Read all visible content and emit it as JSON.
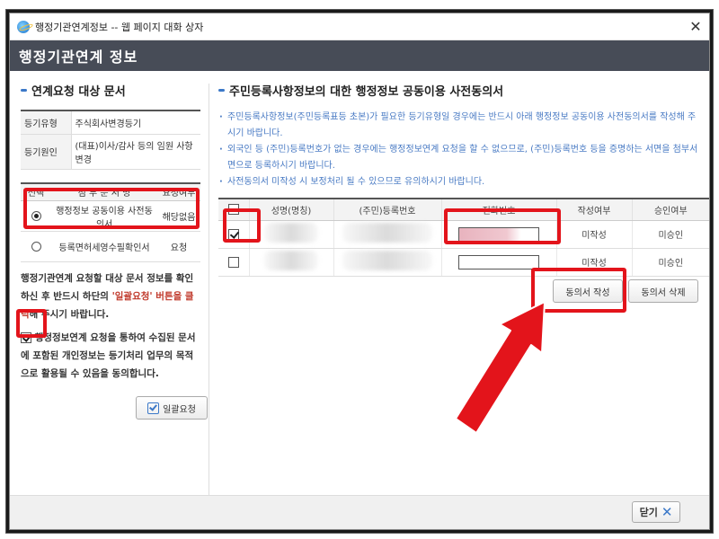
{
  "window": {
    "title": "행정기관연계정보 -- 웹 페이지 대화 상자",
    "close_glyph": "✕"
  },
  "header": {
    "title": "행정기관연계 정보"
  },
  "left": {
    "section_title": "연계요청 대상 문서",
    "info": [
      {
        "key": "등기유형",
        "value": "주식회사변경등기"
      },
      {
        "key": "등기원인",
        "value": "(대표)이사/감사 등의 임원 사항 변경"
      }
    ],
    "doc_table": {
      "headers": [
        "선택",
        "첨 부 문 서 명",
        "요청여부"
      ],
      "rows": [
        {
          "selected": true,
          "name": "행정정보 공동이용 사전동의서",
          "status": "해당없음"
        },
        {
          "selected": false,
          "name": "등록면허세영수필확인서",
          "status": "요청"
        }
      ]
    },
    "notice_pre": "행정기관연계 요청할 대상 문서 정보를 확인하신 후 반드시 하단의 ",
    "notice_red": "'일괄요청' 버튼을 클릭",
    "notice_post": "해 주시기 바랍니다.",
    "consent_checked": true,
    "consent_text": "행정정보연계 요청을 통하여 수집된 문서에 포함된 개인정보는 등기처리 업무의 목적으로 활용될 수 있음을 동의합니다.",
    "bulk_button": "일괄요청"
  },
  "right": {
    "section_title": "주민등록사항정보의 대한 행정정보 공동이용 사전동의서",
    "guide": [
      "주민등록사항정보(주민등록표등 초본)가 필요한 등기유형일 경우에는 반드시 아래 행정정보 공동이용 사전동의서를 작성해 주시기 바랍니다.",
      "외국인 등 (주민)등록번호가 없는 경우에는 행정정보연계 요청을 할 수 없으므로, (주민)등록번호 등을 증명하는 서면을 첨부서면으로 등록하시기 바랍니다.",
      "사전동의서 미작성 시 보정처리 될 수 있으므로 유의하시기 바랍니다."
    ],
    "table": {
      "headers": [
        "성명(명칭)",
        "(주민)등록번호",
        "전화번호",
        "작성여부",
        "승인여부"
      ],
      "rows": [
        {
          "checked": true,
          "write_status": "미작성",
          "approve_status": "미승인"
        },
        {
          "checked": false,
          "write_status": "미작성",
          "approve_status": "미승인"
        }
      ]
    },
    "buttons": {
      "write": "동의서 작성",
      "delete": "동의서 삭제"
    }
  },
  "footer": {
    "close_label": "닫기",
    "close_glyph": "✕"
  },
  "colors": {
    "header_bg": "#474c57",
    "highlight": "#e3141b",
    "guide_text": "#4a7bc4",
    "accent": "#3b78c8"
  }
}
